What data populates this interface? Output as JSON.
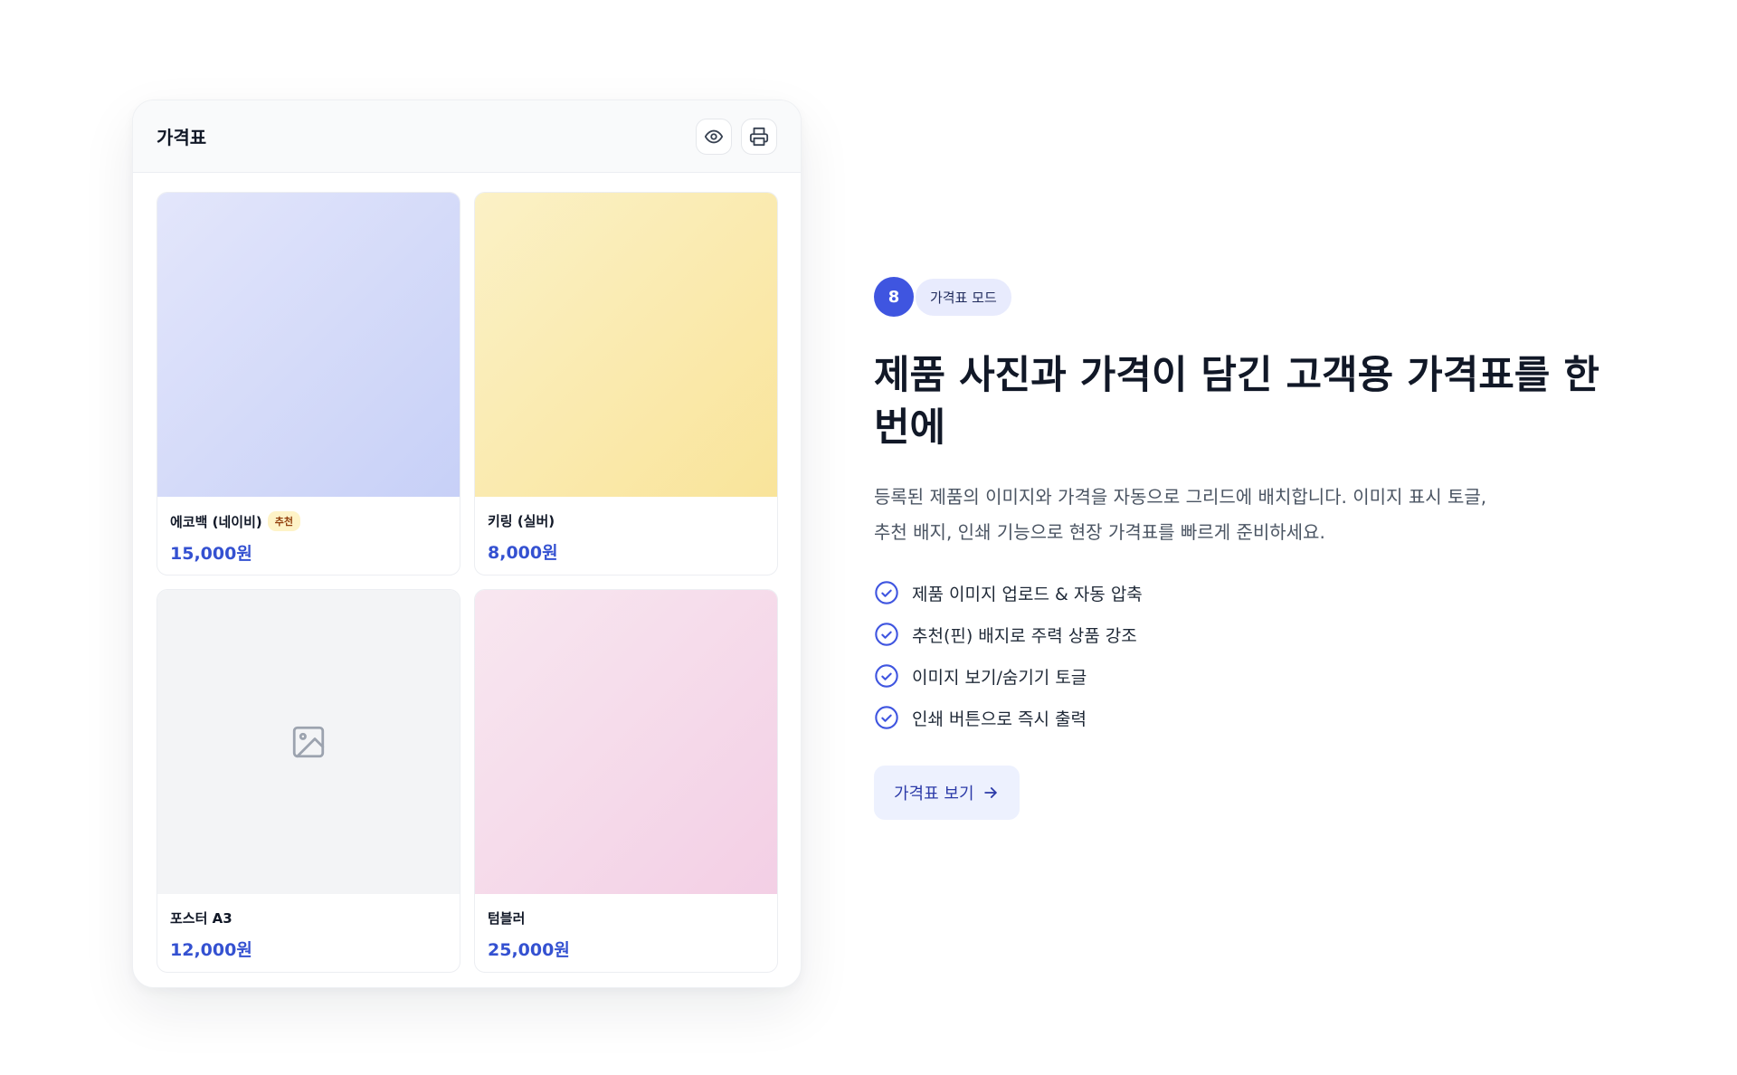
{
  "price_card": {
    "title": "가격표",
    "actions": [
      {
        "name": "eye-icon"
      },
      {
        "name": "printer-icon"
      }
    ],
    "products": [
      {
        "name": "에코백 (네이비)",
        "badge": "추천",
        "price": "15,000원",
        "image": "gradient-navy"
      },
      {
        "name": "키링 (실버)",
        "price": "8,000원",
        "image": "gradient-yellow"
      },
      {
        "name": "포스터 A3",
        "price": "12,000원",
        "image": "image-placeholder-icon"
      },
      {
        "name": "텀블러",
        "price": "25,000원",
        "image": "gradient-pink"
      }
    ]
  },
  "feature": {
    "step_number": "8",
    "step_label": "가격표 모드",
    "headline": "제품 사진과 가격이 담긴 고객용 가격표를 한 번에",
    "description": "등록된 제품의 이미지와 가격을 자동으로 그리드에 배치합니다. 이미지 표시 토글, 추천 배지, 인쇄 기능으로 현장 가격표를 빠르게 준비하세요.",
    "bullets": [
      "제품 이미지 업로드 & 자동 압축",
      "추천(핀) 배지로 주력 상품 강조",
      "이미지 보기/숨기기 토글",
      "인쇄 버튼으로 즉시 출력"
    ],
    "cta_label": "가격표 보기",
    "cta_icon": "arrow-right-icon"
  },
  "colors": {
    "accent": "#3f55e0",
    "price": "#3451d1",
    "badge_bg": "#fef3c7"
  }
}
